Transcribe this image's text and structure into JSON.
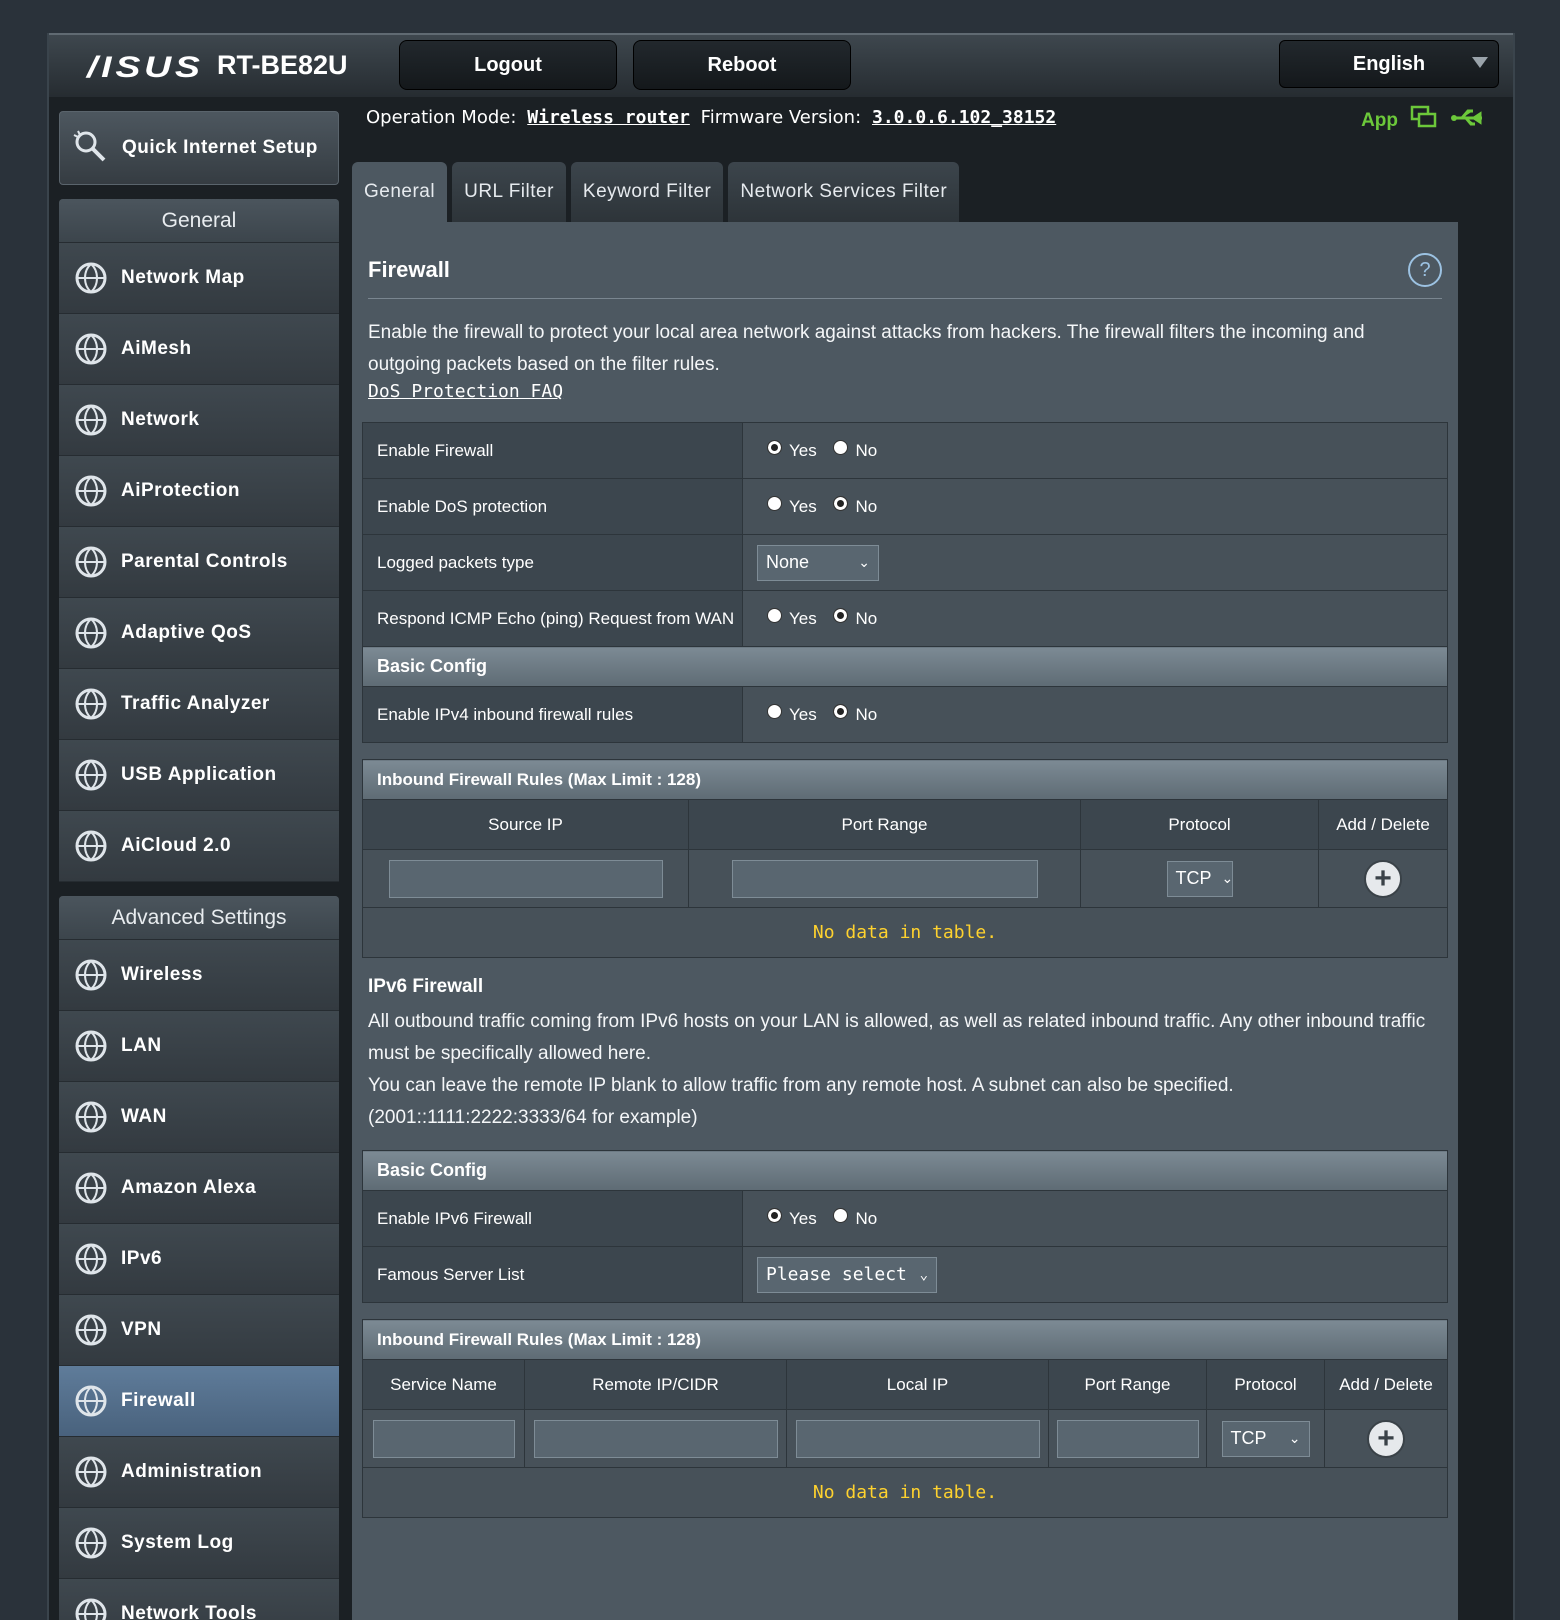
{
  "header": {
    "brand": "/ISUS",
    "model": "RT-BE82U",
    "logout_label": "Logout",
    "reboot_label": "Reboot",
    "language": "English"
  },
  "status": {
    "op_mode_label": "Operation Mode:",
    "op_mode_value": "Wireless router",
    "fw_label": "Firmware Version:",
    "fw_value": "3.0.0.6.102_38152",
    "app_label": "App"
  },
  "sidebar": {
    "qis_label": "Quick Internet Setup",
    "general_title": "General",
    "general_items": [
      {
        "label": "Network Map",
        "icon": "globe-network-icon"
      },
      {
        "label": "AiMesh",
        "icon": "aimesh-icon"
      },
      {
        "label": "Network",
        "icon": "network-globe-icon"
      },
      {
        "label": "AiProtection",
        "icon": "shield-lock-icon"
      },
      {
        "label": "Parental Controls",
        "icon": "family-icon"
      },
      {
        "label": "Adaptive QoS",
        "icon": "speedometer-icon"
      },
      {
        "label": "Traffic Analyzer",
        "icon": "traffic-wave-icon"
      },
      {
        "label": "USB Application",
        "icon": "usb-icon"
      },
      {
        "label": "AiCloud 2.0",
        "icon": "cloud-icon"
      }
    ],
    "advanced_title": "Advanced Settings",
    "advanced_items": [
      {
        "label": "Wireless",
        "icon": "wifi-icon"
      },
      {
        "label": "LAN",
        "icon": "lan-monitor-icon"
      },
      {
        "label": "WAN",
        "icon": "wan-globe-icon"
      },
      {
        "label": "Amazon Alexa",
        "icon": "alexa-icon"
      },
      {
        "label": "IPv6",
        "icon": "ipv6-globe-icon"
      },
      {
        "label": "VPN",
        "icon": "vpn-monitor-icon"
      },
      {
        "label": "Firewall",
        "icon": "firewall-flame-icon",
        "active": true
      },
      {
        "label": "Administration",
        "icon": "gear-person-icon"
      },
      {
        "label": "System Log",
        "icon": "log-pen-icon"
      },
      {
        "label": "Network Tools",
        "icon": "tools-gear-icon"
      }
    ]
  },
  "tabs": [
    "General",
    "URL Filter",
    "Keyword Filter",
    "Network Services Filter"
  ],
  "panel": {
    "title": "Firewall",
    "description": "Enable the firewall to protect your local area network against attacks from hackers. The firewall filters the incoming and outgoing packets based on the filter rules.",
    "faq_link": "DoS Protection FAQ",
    "yes": "Yes",
    "no": "No",
    "rows": [
      {
        "label": "Enable Firewall",
        "value": "No"
      },
      {
        "label": "Enable DoS protection",
        "value": "Yes"
      },
      {
        "label": "Logged packets type",
        "select": "None"
      },
      {
        "label": "Respond ICMP Echo (ping) Request from WAN",
        "value": "Yes"
      }
    ],
    "basic_config": "Basic Config",
    "ipv4_inbound_label": "Enable IPv4 inbound firewall rules",
    "ipv4_inbound_value": "Yes",
    "inbound_rules_title": "Inbound Firewall Rules (Max Limit : 128)",
    "ipv4_columns": [
      "Source IP",
      "Port Range",
      "Protocol",
      "Add / Delete"
    ],
    "protocol": "TCP",
    "no_data": "No data in table.",
    "ipv6_title": "IPv6 Firewall",
    "ipv6_desc_1": "All outbound traffic coming from IPv6 hosts on your LAN is allowed, as well as related inbound traffic. Any other inbound traffic must be specifically allowed here.",
    "ipv6_desc_2": "You can leave the remote IP blank to allow traffic from any remote host. A subnet can also be specified. (2001::1111:2222:3333/64 for example)",
    "ipv6_enable_label": "Enable IPv6 Firewall",
    "ipv6_enable_value": "No",
    "famous_label": "Famous Server List",
    "famous_select": "Please select",
    "ipv6_columns": [
      "Service Name",
      "Remote IP/CIDR",
      "Local IP",
      "Port Range",
      "Protocol",
      "Add / Delete"
    ]
  },
  "colors": {
    "accent": "#6cc83a",
    "nodata": "#ffd22e",
    "active_menu": "#5f7c9a"
  }
}
